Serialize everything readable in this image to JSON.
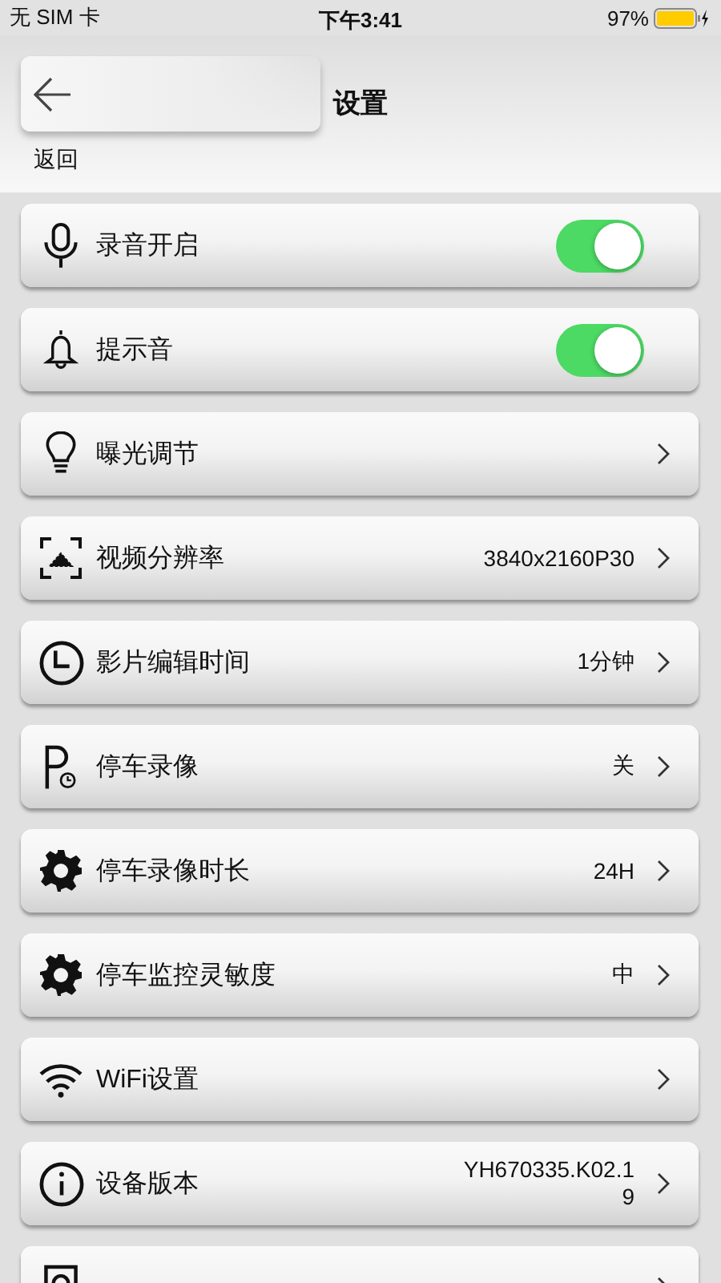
{
  "status_bar": {
    "carrier": "无 SIM 卡",
    "time": "下午3:41",
    "battery": "97%"
  },
  "header": {
    "title": "设置",
    "back_label": "返回"
  },
  "settings": [
    {
      "kind": "toggle",
      "label": "录音开启",
      "on": true
    },
    {
      "kind": "toggle",
      "label": "提示音",
      "on": true
    },
    {
      "kind": "link",
      "label": "曝光调节"
    },
    {
      "kind": "link",
      "label": "视频分辨率",
      "value": "3840x2160P30"
    },
    {
      "kind": "link",
      "label": "影片编辑时间",
      "value": "1分钟"
    },
    {
      "kind": "link",
      "label": "停车录像",
      "value": "关"
    },
    {
      "kind": "link",
      "label": "停车录像时长",
      "value": "24H"
    },
    {
      "kind": "link",
      "label": "停车监控灵敏度",
      "value": "中"
    },
    {
      "kind": "link",
      "label": "WiFi设置"
    },
    {
      "kind": "link",
      "label": "设备版本",
      "value": "YH670335.K02.19"
    },
    {
      "kind": "link"
    }
  ]
}
